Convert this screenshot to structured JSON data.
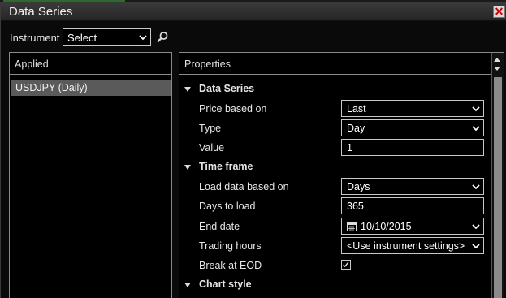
{
  "window": {
    "title": "Data Series"
  },
  "instrument": {
    "label": "Instrument",
    "value": "Select"
  },
  "applied": {
    "header": "Applied",
    "items": [
      {
        "label": "USDJPY (Daily)"
      }
    ]
  },
  "properties": {
    "header": "Properties",
    "sections": [
      {
        "label": "Data Series",
        "rows": [
          {
            "label": "Price based on",
            "value": "Last",
            "kind": "dropdown"
          },
          {
            "label": "Type",
            "value": "Day",
            "kind": "dropdown"
          },
          {
            "label": "Value",
            "value": "1",
            "kind": "text"
          }
        ]
      },
      {
        "label": "Time frame",
        "rows": [
          {
            "label": "Load data based on",
            "value": "Days",
            "kind": "dropdown"
          },
          {
            "label": "Days to load",
            "value": "365",
            "kind": "text"
          },
          {
            "label": "End date",
            "value": "10/10/2015",
            "kind": "date"
          },
          {
            "label": "Trading hours",
            "value": "<Use instrument settings>",
            "kind": "dropdown"
          },
          {
            "label": "Break at EOD",
            "value": true,
            "kind": "checkbox"
          }
        ]
      },
      {
        "label": "Chart style",
        "rows": []
      }
    ]
  },
  "icons": {
    "close": "close-icon",
    "search": "search-icon",
    "calendar": "calendar-icon",
    "expand": "expand-triangle-icon",
    "dropdown": "chevron-down-icon"
  },
  "colors": {
    "background": "#000000",
    "titlebar": "#2e2e2e",
    "selected_row": "#5a5a5a",
    "border": "#8a8a8a",
    "close_x": "#cc0000"
  }
}
